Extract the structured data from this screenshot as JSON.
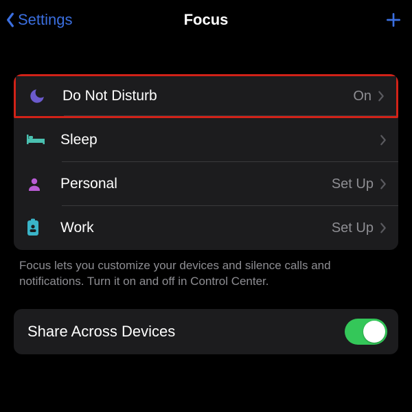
{
  "nav": {
    "back_label": "Settings",
    "title": "Focus"
  },
  "focus_items": [
    {
      "label": "Do Not Disturb",
      "status": "On",
      "icon": "moon",
      "icon_color": "#6b5acd",
      "highlighted": true,
      "chevron": true
    },
    {
      "label": "Sleep",
      "status": "",
      "icon": "bed",
      "icon_color": "#4ac0b0",
      "highlighted": false,
      "chevron": true
    },
    {
      "label": "Personal",
      "status": "Set Up",
      "icon": "person",
      "icon_color": "#b95cd5",
      "highlighted": false,
      "chevron": true
    },
    {
      "label": "Work",
      "status": "Set Up",
      "icon": "badge",
      "icon_color": "#3ab4c8",
      "highlighted": false,
      "chevron": true
    }
  ],
  "footer_note": "Focus lets you customize your devices and silence calls and notifications. Turn it on and off in Control Center.",
  "share_row": {
    "label": "Share Across Devices",
    "enabled": true
  },
  "colors": {
    "accent_blue": "#3b6fe0",
    "switch_green": "#34c759",
    "highlight_red": "#d22218"
  }
}
